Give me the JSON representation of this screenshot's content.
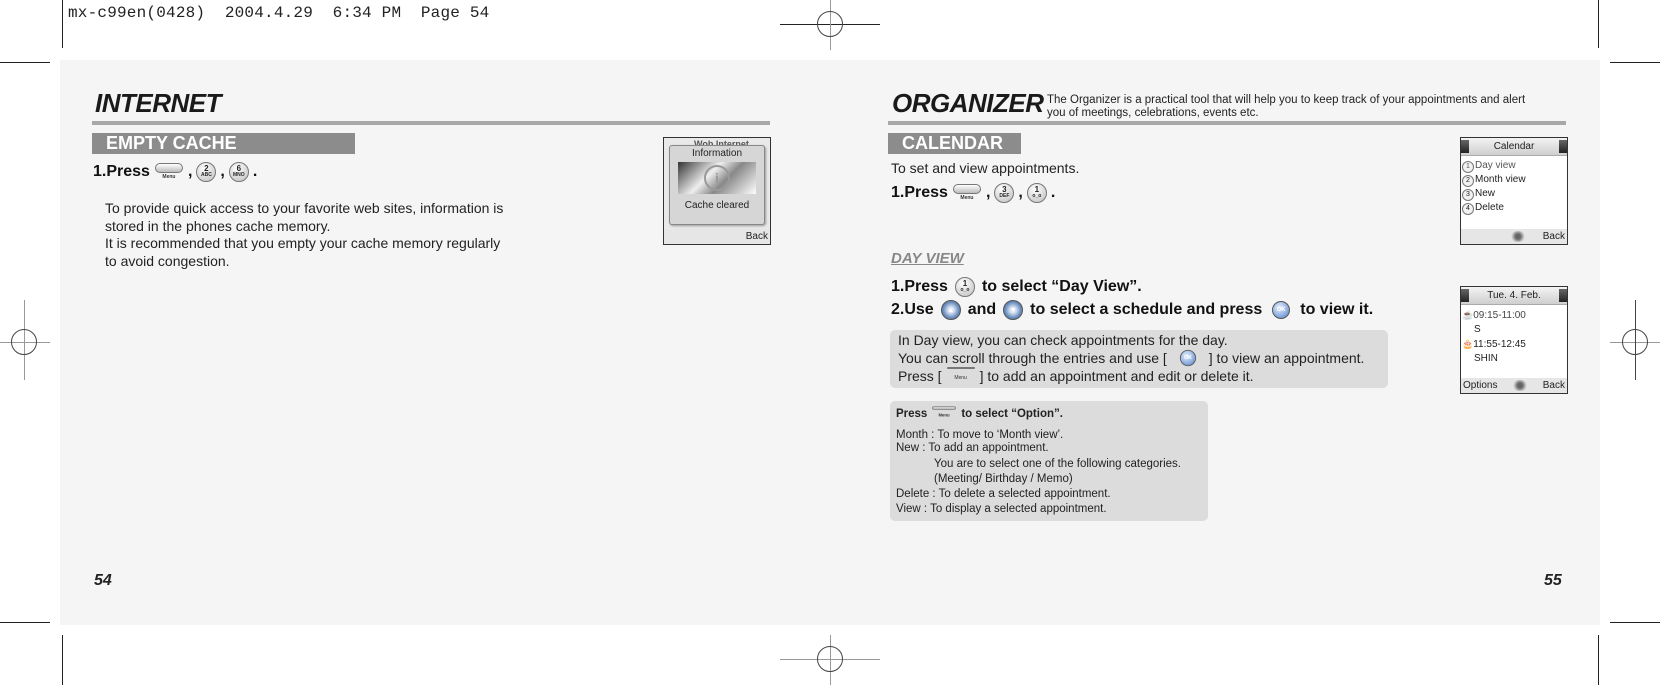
{
  "print_slug": "mx-c99en(0428)  2004.4.29  6:34 PM  Page 54",
  "left_page": {
    "title": "INTERNET",
    "section": "EMPTY CACHE",
    "step1": {
      "prefix": "1.Press",
      "keys": [
        {
          "icon": "menu-key-icon",
          "label": "Menu"
        },
        {
          "icon": "key-2-icon",
          "digit": "2",
          "letters": "ABC"
        },
        {
          "icon": "key-6-icon",
          "digit": "6",
          "letters": "MNO"
        }
      ],
      "sep": ",",
      "end": "."
    },
    "description": [
      "To provide quick access to your favorite web sites, information is",
      "stored in the phones cache memory.",
      "It is recommended that you empty your cache memory regularly",
      "to avoid congestion."
    ],
    "screen": {
      "background_title": "Wob  Internet",
      "popup_title": "Information",
      "popup_icon": "information-icon",
      "message": "Cache cleared",
      "softkey_right": "Back"
    },
    "page_number": "54"
  },
  "right_page": {
    "title": "ORGANIZER",
    "intro": [
      "The Organizer is a practical tool that will help you to keep track of your appointments and alert",
      "you of meetings, celebrations, events etc."
    ],
    "section": "CALENDAR",
    "section_desc": "To set and view appointments.",
    "step1": {
      "prefix": "1.Press",
      "keys": [
        {
          "icon": "menu-key-icon",
          "label": "Menu"
        },
        {
          "icon": "key-3-icon",
          "digit": "3",
          "letters": "DEF"
        },
        {
          "icon": "key-1-icon",
          "digit": "1",
          "letters": "o_o"
        }
      ],
      "sep": ",",
      "end": "."
    },
    "calendar_screen": {
      "title": "Calendar",
      "items": [
        {
          "num": "1",
          "label": "Day view"
        },
        {
          "num": "2",
          "label": "Month view"
        },
        {
          "num": "3",
          "label": "New"
        },
        {
          "num": "4",
          "label": "Delete"
        }
      ],
      "softkey_right": "Back"
    },
    "day_view": {
      "title": "DAY VIEW",
      "step1": {
        "prefix": "1.Press",
        "suffix": "to select “Day View”.",
        "key_digit": "1",
        "key_letters": "o_o"
      },
      "step2": {
        "prefix": "2.Use",
        "mid1": "and",
        "mid2": "to select a schedule and press",
        "suffix": "to view it.",
        "ok": "OK"
      },
      "info_box": {
        "line1": "In Day view, you can check appointments for the day.",
        "line2_pre": "You can scroll through the entries and use [",
        "line2_post": "] to view an appointment.",
        "line3_pre": "Press [",
        "line3_post": "] to add an appointment and edit or delete it.",
        "ok": "OK",
        "menu": "Menu"
      },
      "options_box": {
        "head_pre": "Press",
        "head_post": "to select “Option”.",
        "menu": "Menu",
        "lines": [
          "Month : To move to ‘Month view’.",
          "New : To add an appointment."
        ],
        "indented": [
          "You are to select one of the following categories.",
          "(Meeting/ Birthday / Memo)"
        ],
        "tail": [
          "Delete : To delete a selected appointment.",
          "View : To display a selected appointment."
        ]
      },
      "day_screen": {
        "title": "Tue. 4. Feb.",
        "entries": [
          {
            "icon": "meeting-icon",
            "time": "09:15-11:00",
            "name": "S"
          },
          {
            "icon": "birthday-icon",
            "time": "11:55-12:45",
            "name": "SHIN"
          }
        ],
        "softkey_left": "Options",
        "softkey_right": "Back"
      }
    },
    "page_number": "55"
  }
}
